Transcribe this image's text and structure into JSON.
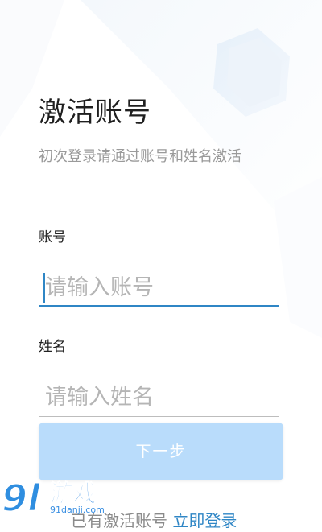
{
  "page": {
    "title": "激活账号",
    "subtitle": "初次登录请通过账号和姓名激活"
  },
  "form": {
    "account": {
      "label": "账号",
      "placeholder": "请输入账号",
      "value": ""
    },
    "name": {
      "label": "姓名",
      "placeholder": "请输入姓名",
      "value": ""
    },
    "next_button_label": "下一步"
  },
  "footer": {
    "prompt_text": "已有激活账号",
    "login_link": "立即登录"
  },
  "watermark": {
    "number": "9l",
    "text": "游戏",
    "domain": "91danji.com"
  },
  "colors": {
    "accent": "#2f86c5",
    "button_disabled": "#b9dcfb",
    "placeholder": "#b5b5b5",
    "subtitle": "#9a9a9a"
  },
  "icons": {
    "background": "decorative-hexagon-shape"
  }
}
